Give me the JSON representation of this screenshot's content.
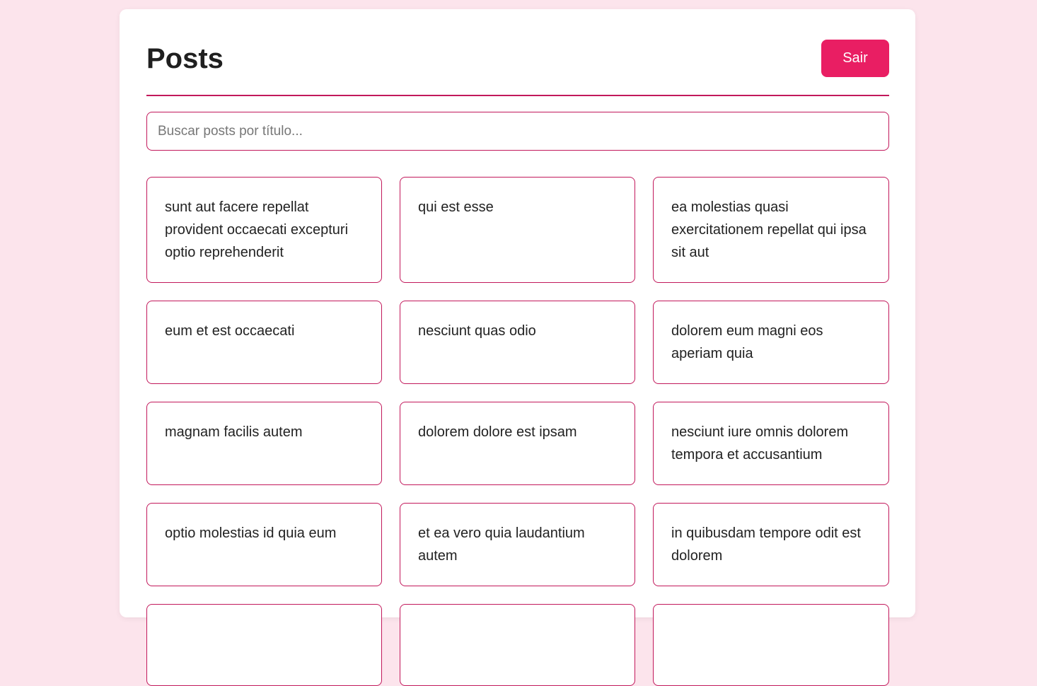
{
  "header": {
    "title": "Posts",
    "logout_label": "Sair"
  },
  "search": {
    "placeholder": "Buscar posts por título...",
    "value": ""
  },
  "posts": [
    "sunt aut facere repellat provident occaecati excepturi optio reprehenderit",
    "qui est esse",
    "ea molestias quasi exercitationem repellat qui ipsa sit aut",
    "eum et est occaecati",
    "nesciunt quas odio",
    "dolorem eum magni eos aperiam quia",
    "magnam facilis autem",
    "dolorem dolore est ipsam",
    "nesciunt iure omnis dolorem tempora et accusantium",
    "optio molestias id quia eum",
    "et ea vero quia laudantium autem",
    "in quibusdam tempore odit est dolorem",
    "",
    "",
    ""
  ],
  "colors": {
    "background": "#fce4ec",
    "accent": "#e91e63",
    "border": "#c2185b"
  }
}
